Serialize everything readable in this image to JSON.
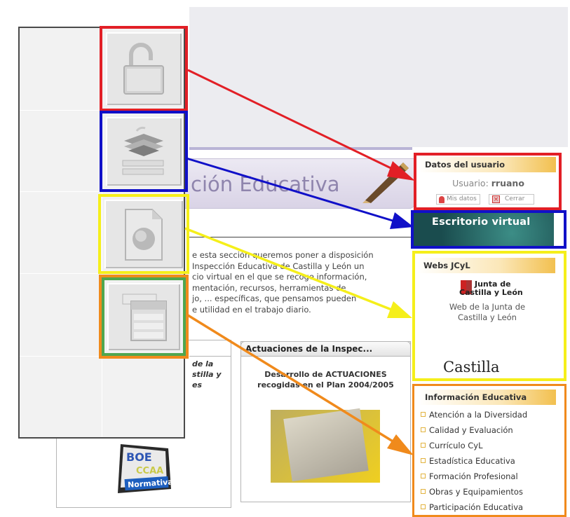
{
  "colors": {
    "red": "#e21f26",
    "blue": "#1010c8",
    "yellow": "#f5ef1a",
    "orange": "#f08a1c",
    "green": "#4fa64f",
    "header_gold": "#f2c04f"
  },
  "page": {
    "title": "ción Educativa",
    "intro": "e esta sección queremos poner a disposición\nInspección Educativa de Castilla y León un\ncio virtual en el que se recoge información,\nmentación, recursos, herramientas de\njo, ... específicas, que pensamos pueden\ne utilidad en el trabajo diario.",
    "left_panel_text": "de la\nstilla y\nes",
    "actuaciones": {
      "title": "Actuaciones de la Inspec...",
      "body": "Desarrollo de ACTUACIONES\nrecogidas en el Plan  2004/2005"
    },
    "boe_badge": {
      "top": "BOE",
      "mid": "CCAA",
      "bottom": "Normativa"
    }
  },
  "sidebar_tiles": [
    {
      "icon": "padlock-icon",
      "frame": "red"
    },
    {
      "icon": "graduation-cap-icon",
      "frame": "blue"
    },
    {
      "icon": "document-sphere-icon",
      "frame": "yellow"
    },
    {
      "icon": "stacked-windows-icon",
      "frame": "orange"
    }
  ],
  "datos_usuario": {
    "title": "Datos del usuario",
    "user_label": "Usuario:",
    "user_name": "rruano",
    "mis_datos": "Mis datos",
    "cerrar": "Cerrar"
  },
  "escritorio": {
    "label": "Escritorio virtual"
  },
  "webs": {
    "title": "Webs JCyL",
    "logo_line1": "Junta de",
    "logo_line2": "Castilla y León",
    "link_text": "Web de la Junta de\nCastilla y León",
    "castilla_logo": "Castilla"
  },
  "informacion": {
    "title": "Información Educativa",
    "items": [
      "Atención a la Diversidad",
      "Calidad y Evaluación",
      "Currículo CyL",
      "Estadística Educativa",
      "Formación Profesional",
      "Obras y Equipamientos",
      "Participación Educativa"
    ]
  }
}
